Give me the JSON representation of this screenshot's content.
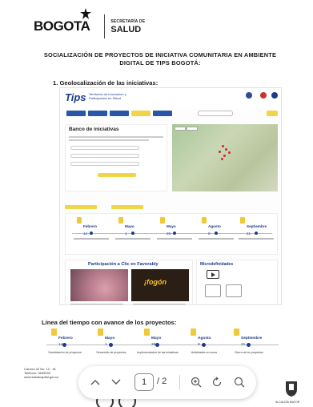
{
  "header": {
    "logo_text": "BOGOTA",
    "secretaria_small": "SECRETARÍA DE",
    "secretaria_big": "SALUD"
  },
  "document": {
    "title": "SOCIALIZACIÓN DE PROYECTOS DE INICIATIVA COMUNITARIA EN AMBIENTE DIGITAL DE TIPS BOGOTÁ:",
    "section1": "1.  Geolocalización de las iniciativas:",
    "section2": "Línea del tiempo con avance de los proyectos:"
  },
  "website": {
    "logo": "Tips",
    "logo_sub": "Territorios de Innovación y Participación en Salud",
    "bank_title": "Banco de iniciativas",
    "map_tabs": [
      "Mapa",
      "Sitio"
    ],
    "participation_title": "Participación a Clic en Favorably",
    "fogon_text": "¡fogón",
    "micro_title": "Microdefinidades",
    "timeline": [
      {
        "month": "Febrero",
        "day": "14"
      },
      {
        "month": "Mayo",
        "day": "1"
      },
      {
        "month": "Mayo",
        "day": "26"
      },
      {
        "month": "Agosto",
        "day": "9"
      },
      {
        "month": "Septiembre",
        "day": "21"
      }
    ]
  },
  "timeline": [
    {
      "month": "Febrero",
      "day": "14",
      "caption": "Socialización de proyectos"
    },
    {
      "month": "Mayo",
      "day": "1",
      "caption": "Desarrollo de proyectos"
    },
    {
      "month": "Mayo",
      "day": "26",
      "caption": "Implementación de las iniciativas"
    },
    {
      "month": "Agosto",
      "day": "9",
      "caption": "Actividades en curso"
    },
    {
      "month": "Septiembre",
      "day": "21",
      "caption": "Cierre de los proyectos"
    }
  ],
  "footer": {
    "line1": "Carrera 32 No. 12 - 81",
    "line2": "Teléfono: 3649090",
    "line3": "www.saludcapital.gov.co",
    "seal_text": "ALCALDÍA MAYOR"
  },
  "pdf_toolbar": {
    "current_page": "1",
    "total_pages": "/ 2",
    "icons": [
      "chevron-up-icon",
      "chevron-down-icon",
      "zoom-in-icon",
      "rotate-icon",
      "search-icon"
    ]
  }
}
